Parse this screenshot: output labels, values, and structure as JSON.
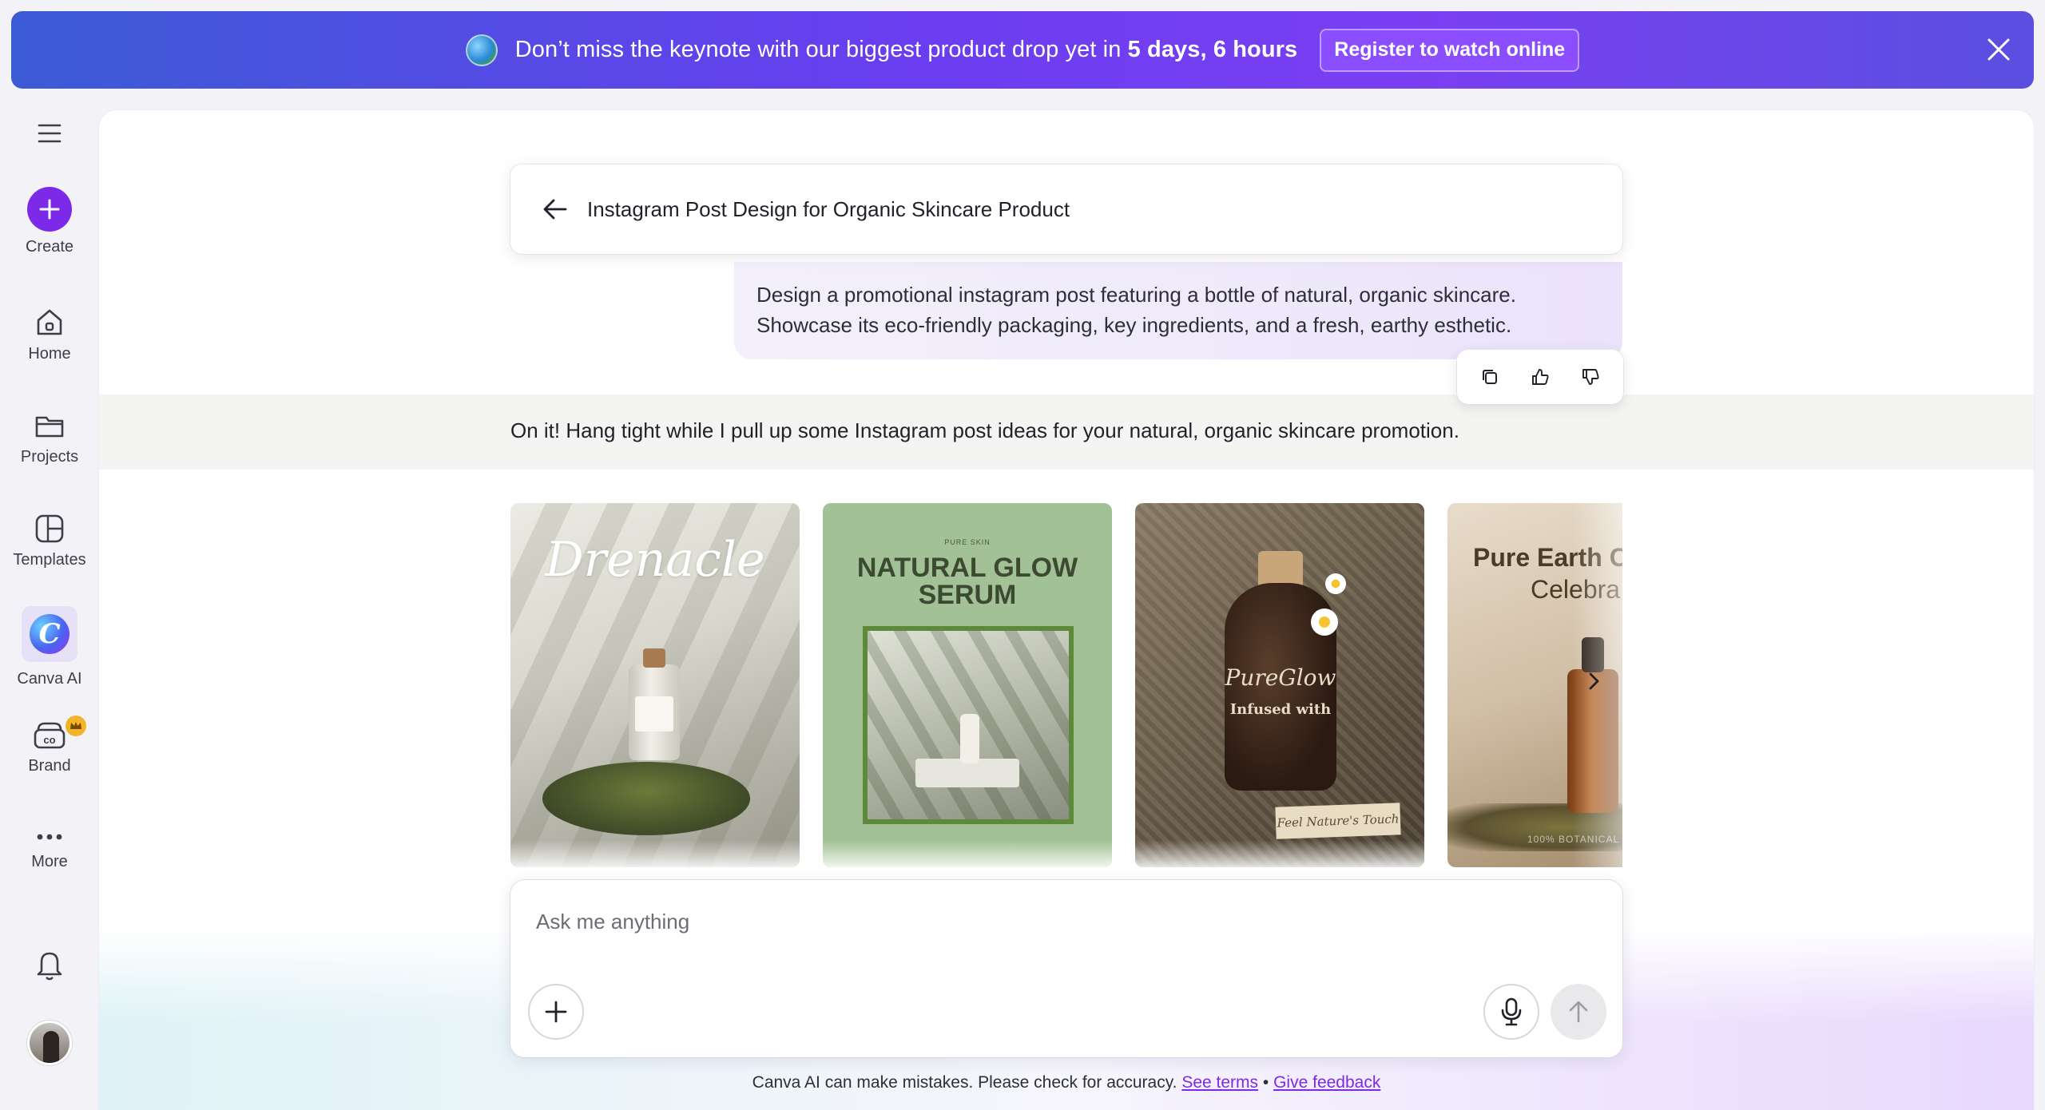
{
  "banner": {
    "message_prefix": "Don’t miss the keynote with our biggest product drop yet in",
    "countdown": "5 days, 6 hours",
    "register_label": "Register to watch online"
  },
  "sidebar": {
    "items": [
      {
        "label": "Create"
      },
      {
        "label": "Home"
      },
      {
        "label": "Projects"
      },
      {
        "label": "Templates"
      },
      {
        "label": "Canva AI"
      },
      {
        "label": "Brand"
      },
      {
        "label": "More"
      }
    ]
  },
  "conversation": {
    "title": "Instagram Post Design for Organic Skincare Product",
    "prompt_line1": "Design a promotional instagram post featuring a bottle of natural, organic skincare.",
    "prompt_line2": "Showcase its eco-friendly packaging, key ingredients, and a fresh, earthy esthetic.",
    "reply": "On it! Hang tight while I pull up some Instagram post ideas for your natural, organic skincare promotion."
  },
  "designs": [
    {
      "brand": "Drenacle"
    },
    {
      "eyebrow": "PURE SKIN",
      "headline": "NATURAL GLOW SERUM"
    },
    {
      "brand": "PureGlow",
      "subtitle": "Infused with",
      "tag": "Feel Nature's Touch"
    },
    {
      "headline_line1": "Pure Earth C",
      "headline_line2": "Celebra",
      "footer": "100% BOTANICAL"
    }
  ],
  "composer": {
    "placeholder": "Ask me anything"
  },
  "footer": {
    "disclaimer": "Canva AI can make mistakes. Please check for accuracy.",
    "terms_link": "See terms",
    "separator": "•",
    "feedback_link": "Give feedback"
  },
  "colors": {
    "accent": "#7d2ae8",
    "banner_start": "#3b5bd6",
    "banner_end": "#7b3ff2"
  }
}
